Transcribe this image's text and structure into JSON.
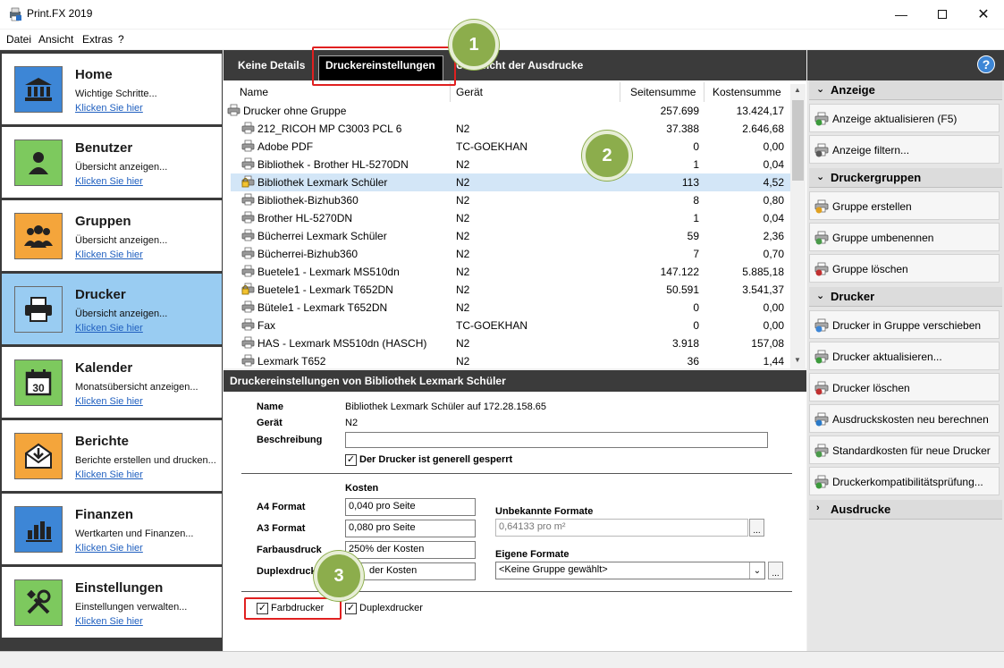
{
  "window": {
    "title": "Print.FX 2019"
  },
  "menu": [
    "Datei",
    "Ansicht",
    "Extras",
    "?"
  ],
  "nav": [
    {
      "title": "Home",
      "sub": "Wichtige Schritte...",
      "link": "Klicken Sie hier",
      "icon": "home-bank-icon",
      "color": "#3d86d6"
    },
    {
      "title": "Benutzer",
      "sub": "Übersicht anzeigen...",
      "link": "Klicken Sie hier",
      "icon": "user-icon",
      "color": "#7dc95e"
    },
    {
      "title": "Gruppen",
      "sub": "Übersicht anzeigen...",
      "link": "Klicken Sie hier",
      "icon": "group-icon",
      "color": "#f4a53b"
    },
    {
      "title": "Drucker",
      "sub": "Übersicht anzeigen...",
      "link": "Klicken Sie hier",
      "icon": "printer-icon",
      "color": "#99ccf2"
    },
    {
      "title": "Kalender",
      "sub": "Monatsübersicht anzeigen...",
      "link": "Klicken Sie hier",
      "icon": "calendar-icon",
      "color": "#7dc95e"
    },
    {
      "title": "Berichte",
      "sub": "Berichte erstellen und drucken...",
      "link": "Klicken Sie hier",
      "icon": "report-icon",
      "color": "#f4a53b"
    },
    {
      "title": "Finanzen",
      "sub": "Wertkarten und Finanzen...",
      "link": "Klicken Sie hier",
      "icon": "finance-chart-icon",
      "color": "#3d86d6"
    },
    {
      "title": "Einstellungen",
      "sub": "Einstellungen verwalten...",
      "link": "Klicken Sie hier",
      "icon": "tools-icon",
      "color": "#7dc95e"
    }
  ],
  "nav_active": 3,
  "tabs": [
    "Keine Details",
    "Druckereinstellungen",
    "Übersicht der Ausdrucke"
  ],
  "columns": {
    "name": "Name",
    "device": "Gerät",
    "pages": "Seitensumme",
    "costs": "Kostensumme"
  },
  "printers": [
    {
      "name": "Drucker ohne Gruppe",
      "device": "",
      "pages": "257.699",
      "costs": "13.424,17",
      "group": true
    },
    {
      "name": "212_RICOH MP C3003 PCL 6",
      "device": "N2",
      "pages": "37.388",
      "costs": "2.646,68"
    },
    {
      "name": "Adobe PDF",
      "device": "TC-GOEKHAN",
      "pages": "0",
      "costs": "0,00"
    },
    {
      "name": "Bibliothek - Brother HL-5270DN",
      "device": "N2",
      "pages": "1",
      "costs": "0,04"
    },
    {
      "name": "Bibliothek Lexmark Schüler",
      "device": "N2",
      "pages": "113",
      "costs": "4,52",
      "selected": true,
      "locked": true
    },
    {
      "name": "Bibliothek-Bizhub360",
      "device": "N2",
      "pages": "8",
      "costs": "0,80"
    },
    {
      "name": "Brother HL-5270DN",
      "device": "N2",
      "pages": "1",
      "costs": "0,04"
    },
    {
      "name": "Bücherrei Lexmark Schüler",
      "device": "N2",
      "pages": "59",
      "costs": "2,36"
    },
    {
      "name": "Bücherrei-Bizhub360",
      "device": "N2",
      "pages": "7",
      "costs": "0,70"
    },
    {
      "name": "Buetele1 - Lexmark MS510dn",
      "device": "N2",
      "pages": "147.122",
      "costs": "5.885,18"
    },
    {
      "name": "Buetele1 - Lexmark T652DN",
      "device": "N2",
      "pages": "50.591",
      "costs": "3.541,37",
      "locked": true
    },
    {
      "name": "Bütele1 - Lexmark T652DN",
      "device": "N2",
      "pages": "0",
      "costs": "0,00"
    },
    {
      "name": "Fax",
      "device": "TC-GOEKHAN",
      "pages": "0",
      "costs": "0,00"
    },
    {
      "name": "HAS - Lexmark MS510dn (HASCH)",
      "device": "N2",
      "pages": "3.918",
      "costs": "157,08"
    },
    {
      "name": "Lexmark T652",
      "device": "N2",
      "pages": "36",
      "costs": "1,44"
    }
  ],
  "detail": {
    "title": "Druckereinstellungen von Bibliothek Lexmark Schüler",
    "name_label": "Name",
    "name_value": "Bibliothek Lexmark Schüler auf 172.28.158.65",
    "device_label": "Gerät",
    "device_value": "N2",
    "desc_label": "Beschreibung",
    "desc_value": "",
    "locked_label": "Der Drucker ist generell gesperrt",
    "costs_header": "Kosten",
    "a4_label": "A4 Format",
    "a4_value": "0,040 pro Seite",
    "a3_label": "A3 Format",
    "a3_value": "0,080 pro Seite",
    "color_label": "Farbausdruck",
    "color_value": "250% der Kosten",
    "duplex_label": "Duplexdruck",
    "duplex_value": "der Kosten",
    "unknown_label": "Unbekannte Formate",
    "unknown_value": "0,64133 pro m²",
    "own_label": "Eigene Formate",
    "own_value": "<Keine Gruppe gewählt>",
    "color_printer_label": "Farbdrucker",
    "duplex_printer_label": "Duplexdrucker",
    "ellipsis": "..."
  },
  "right": {
    "help": "?",
    "sections": [
      {
        "title": "Anzeige",
        "actions": [
          {
            "label": "Anzeige aktualisieren (F5)",
            "icon": "refresh-icon"
          },
          {
            "label": "Anzeige filtern...",
            "icon": "filter-icon"
          }
        ]
      },
      {
        "title": "Druckergruppen",
        "actions": [
          {
            "label": "Gruppe erstellen",
            "icon": "group-add-icon"
          },
          {
            "label": "Gruppe umbenennen",
            "icon": "group-rename-icon"
          },
          {
            "label": "Gruppe löschen",
            "icon": "group-delete-icon"
          }
        ]
      },
      {
        "title": "Drucker",
        "actions": [
          {
            "label": "Drucker in Gruppe verschieben",
            "icon": "printer-move-icon"
          },
          {
            "label": "Drucker aktualisieren...",
            "icon": "printer-refresh-icon"
          },
          {
            "label": "Drucker löschen",
            "icon": "printer-delete-icon"
          },
          {
            "label": "Ausdruckskosten neu berechnen",
            "icon": "recalc-icon"
          },
          {
            "label": "Standardkosten für neue Drucker",
            "icon": "printer-default-cost-icon"
          },
          {
            "label": "Druckerkompatibilitätsprüfung...",
            "icon": "printer-check-icon"
          }
        ]
      },
      {
        "title": "Ausdrucke",
        "actions": []
      }
    ]
  },
  "callouts": [
    "1",
    "2",
    "3"
  ]
}
